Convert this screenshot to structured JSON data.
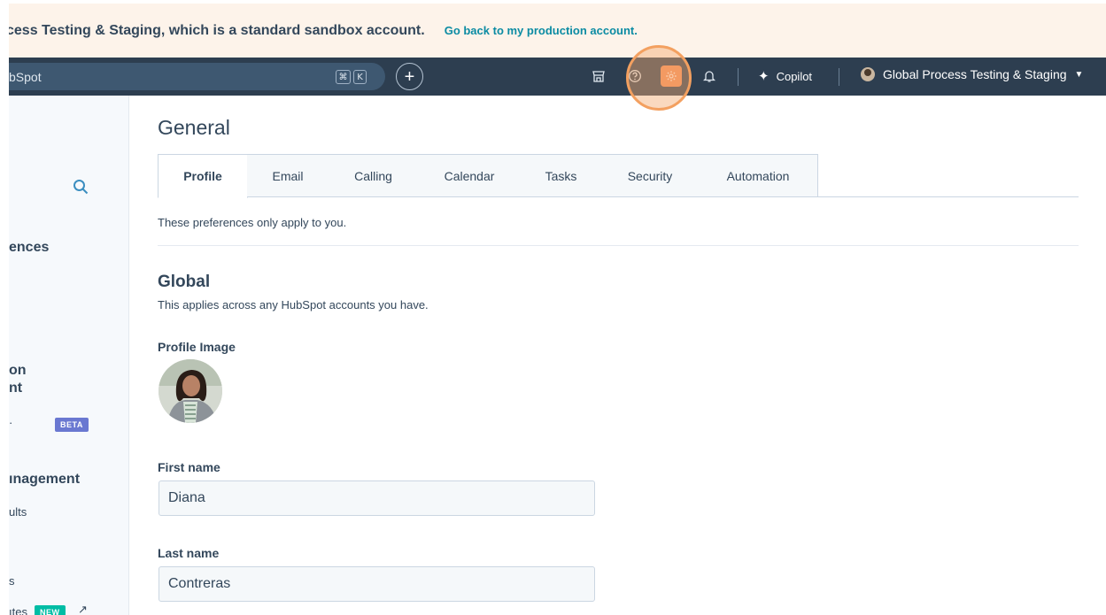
{
  "banner": {
    "text": "cess Testing & Staging, which is a standard sandbox account.",
    "link": "Go back to my production account."
  },
  "topnav": {
    "search_text": "bSpot",
    "shortcut_key1": "⌘",
    "shortcut_key2": "K",
    "copilot_label": "Copilot",
    "account_name": "Global Process Testing & Staging",
    "icons": [
      "marketplace-icon",
      "help-icon",
      "settings-icon",
      "notifications-icon"
    ]
  },
  "sidebar": {
    "heading_prefs": "ences",
    "heading_on": "on",
    "heading_nt": "nt",
    "item_dot": "·",
    "badge_beta": "BETA",
    "heading_mgmt": "ınagement",
    "item_ults": "ults",
    "item_s": "s",
    "item_tes": "ıtes",
    "badge_new": "NEW"
  },
  "main": {
    "title": "General",
    "tabs": [
      {
        "label": "Profile",
        "active": true
      },
      {
        "label": "Email",
        "active": false
      },
      {
        "label": "Calling",
        "active": false
      },
      {
        "label": "Calendar",
        "active": false
      },
      {
        "label": "Tasks",
        "active": false
      },
      {
        "label": "Security",
        "active": false
      },
      {
        "label": "Automation",
        "active": false
      }
    ],
    "prefs_note": "These preferences only apply to you.",
    "global_title": "Global",
    "global_sub": "This applies across any HubSpot accounts you have.",
    "profile_image_label": "Profile Image",
    "first_name_label": "First name",
    "first_name_value": "Diana",
    "last_name_label": "Last name",
    "last_name_value": "Contreras"
  },
  "colors": {
    "nav_bg": "#2d3e50",
    "banner_bg": "#fdf3ea",
    "accent_teal": "#0b8ba3",
    "gear_highlight": "#f28d57"
  }
}
